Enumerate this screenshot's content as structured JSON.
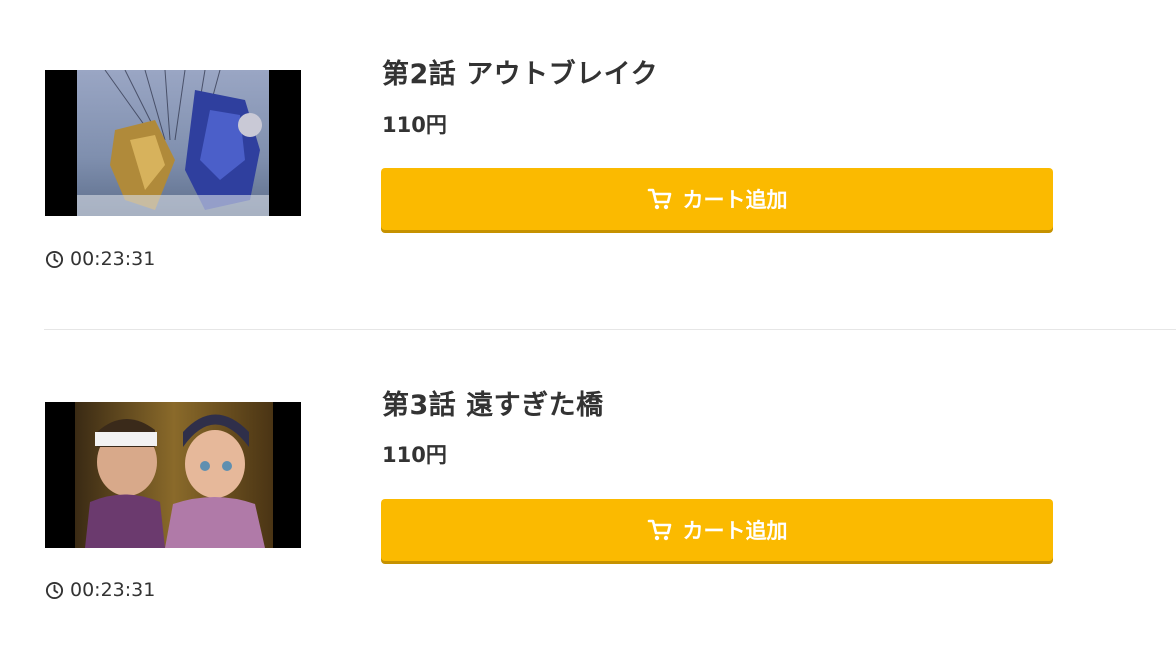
{
  "episodes": [
    {
      "title": "第2話 アウトブレイク",
      "price": "110円",
      "cart_label": "カート追加",
      "duration": "00:23:31",
      "cart_icon": "cart-icon",
      "clock_icon": "clock-icon"
    },
    {
      "title": "第3話 遠すぎた橋",
      "price": "110円",
      "cart_label": "カート追加",
      "duration": "00:23:31",
      "cart_icon": "cart-icon",
      "clock_icon": "clock-icon"
    }
  ],
  "colors": {
    "button": "#fbba00",
    "button_shadow": "#c69200",
    "text": "#333333",
    "divider": "#e6e6e6"
  }
}
